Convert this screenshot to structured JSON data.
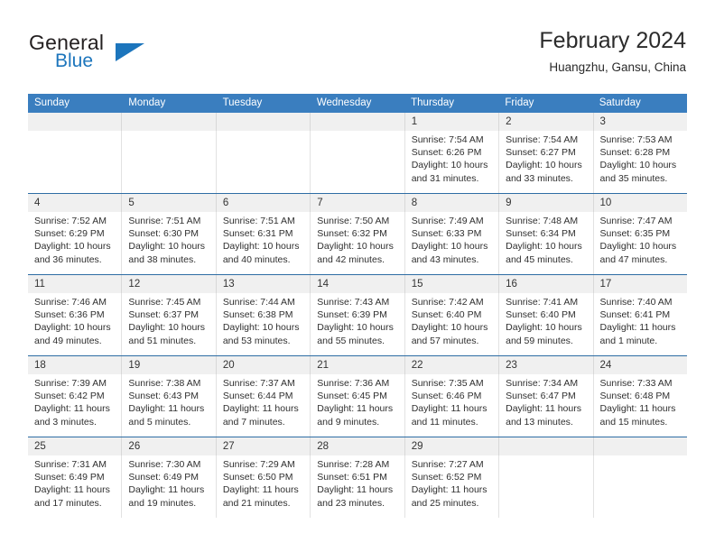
{
  "brand": {
    "name_part1": "General",
    "name_part2": "Blue",
    "logo_icon": "triangle-icon",
    "accent_color": "#1c75bc"
  },
  "header": {
    "title": "February 2024",
    "subtitle": "Huangzhu, Gansu, China"
  },
  "colors": {
    "header_blue": "#3a7ebf",
    "week_divider": "#2e6da4",
    "date_strip": "#f0f0f0"
  },
  "weekdays": [
    "Sunday",
    "Monday",
    "Tuesday",
    "Wednesday",
    "Thursday",
    "Friday",
    "Saturday"
  ],
  "weeks": [
    {
      "days": [
        {
          "date": "",
          "empty": true
        },
        {
          "date": "",
          "empty": true
        },
        {
          "date": "",
          "empty": true
        },
        {
          "date": "",
          "empty": true
        },
        {
          "date": "1",
          "sunrise": "Sunrise: 7:54 AM",
          "sunset": "Sunset: 6:26 PM",
          "daylight1": "Daylight: 10 hours",
          "daylight2": "and 31 minutes."
        },
        {
          "date": "2",
          "sunrise": "Sunrise: 7:54 AM",
          "sunset": "Sunset: 6:27 PM",
          "daylight1": "Daylight: 10 hours",
          "daylight2": "and 33 minutes."
        },
        {
          "date": "3",
          "sunrise": "Sunrise: 7:53 AM",
          "sunset": "Sunset: 6:28 PM",
          "daylight1": "Daylight: 10 hours",
          "daylight2": "and 35 minutes."
        }
      ]
    },
    {
      "days": [
        {
          "date": "4",
          "sunrise": "Sunrise: 7:52 AM",
          "sunset": "Sunset: 6:29 PM",
          "daylight1": "Daylight: 10 hours",
          "daylight2": "and 36 minutes."
        },
        {
          "date": "5",
          "sunrise": "Sunrise: 7:51 AM",
          "sunset": "Sunset: 6:30 PM",
          "daylight1": "Daylight: 10 hours",
          "daylight2": "and 38 minutes."
        },
        {
          "date": "6",
          "sunrise": "Sunrise: 7:51 AM",
          "sunset": "Sunset: 6:31 PM",
          "daylight1": "Daylight: 10 hours",
          "daylight2": "and 40 minutes."
        },
        {
          "date": "7",
          "sunrise": "Sunrise: 7:50 AM",
          "sunset": "Sunset: 6:32 PM",
          "daylight1": "Daylight: 10 hours",
          "daylight2": "and 42 minutes."
        },
        {
          "date": "8",
          "sunrise": "Sunrise: 7:49 AM",
          "sunset": "Sunset: 6:33 PM",
          "daylight1": "Daylight: 10 hours",
          "daylight2": "and 43 minutes."
        },
        {
          "date": "9",
          "sunrise": "Sunrise: 7:48 AM",
          "sunset": "Sunset: 6:34 PM",
          "daylight1": "Daylight: 10 hours",
          "daylight2": "and 45 minutes."
        },
        {
          "date": "10",
          "sunrise": "Sunrise: 7:47 AM",
          "sunset": "Sunset: 6:35 PM",
          "daylight1": "Daylight: 10 hours",
          "daylight2": "and 47 minutes."
        }
      ]
    },
    {
      "days": [
        {
          "date": "11",
          "sunrise": "Sunrise: 7:46 AM",
          "sunset": "Sunset: 6:36 PM",
          "daylight1": "Daylight: 10 hours",
          "daylight2": "and 49 minutes."
        },
        {
          "date": "12",
          "sunrise": "Sunrise: 7:45 AM",
          "sunset": "Sunset: 6:37 PM",
          "daylight1": "Daylight: 10 hours",
          "daylight2": "and 51 minutes."
        },
        {
          "date": "13",
          "sunrise": "Sunrise: 7:44 AM",
          "sunset": "Sunset: 6:38 PM",
          "daylight1": "Daylight: 10 hours",
          "daylight2": "and 53 minutes."
        },
        {
          "date": "14",
          "sunrise": "Sunrise: 7:43 AM",
          "sunset": "Sunset: 6:39 PM",
          "daylight1": "Daylight: 10 hours",
          "daylight2": "and 55 minutes."
        },
        {
          "date": "15",
          "sunrise": "Sunrise: 7:42 AM",
          "sunset": "Sunset: 6:40 PM",
          "daylight1": "Daylight: 10 hours",
          "daylight2": "and 57 minutes."
        },
        {
          "date": "16",
          "sunrise": "Sunrise: 7:41 AM",
          "sunset": "Sunset: 6:40 PM",
          "daylight1": "Daylight: 10 hours",
          "daylight2": "and 59 minutes."
        },
        {
          "date": "17",
          "sunrise": "Sunrise: 7:40 AM",
          "sunset": "Sunset: 6:41 PM",
          "daylight1": "Daylight: 11 hours",
          "daylight2": "and 1 minute."
        }
      ]
    },
    {
      "days": [
        {
          "date": "18",
          "sunrise": "Sunrise: 7:39 AM",
          "sunset": "Sunset: 6:42 PM",
          "daylight1": "Daylight: 11 hours",
          "daylight2": "and 3 minutes."
        },
        {
          "date": "19",
          "sunrise": "Sunrise: 7:38 AM",
          "sunset": "Sunset: 6:43 PM",
          "daylight1": "Daylight: 11 hours",
          "daylight2": "and 5 minutes."
        },
        {
          "date": "20",
          "sunrise": "Sunrise: 7:37 AM",
          "sunset": "Sunset: 6:44 PM",
          "daylight1": "Daylight: 11 hours",
          "daylight2": "and 7 minutes."
        },
        {
          "date": "21",
          "sunrise": "Sunrise: 7:36 AM",
          "sunset": "Sunset: 6:45 PM",
          "daylight1": "Daylight: 11 hours",
          "daylight2": "and 9 minutes."
        },
        {
          "date": "22",
          "sunrise": "Sunrise: 7:35 AM",
          "sunset": "Sunset: 6:46 PM",
          "daylight1": "Daylight: 11 hours",
          "daylight2": "and 11 minutes."
        },
        {
          "date": "23",
          "sunrise": "Sunrise: 7:34 AM",
          "sunset": "Sunset: 6:47 PM",
          "daylight1": "Daylight: 11 hours",
          "daylight2": "and 13 minutes."
        },
        {
          "date": "24",
          "sunrise": "Sunrise: 7:33 AM",
          "sunset": "Sunset: 6:48 PM",
          "daylight1": "Daylight: 11 hours",
          "daylight2": "and 15 minutes."
        }
      ]
    },
    {
      "days": [
        {
          "date": "25",
          "sunrise": "Sunrise: 7:31 AM",
          "sunset": "Sunset: 6:49 PM",
          "daylight1": "Daylight: 11 hours",
          "daylight2": "and 17 minutes."
        },
        {
          "date": "26",
          "sunrise": "Sunrise: 7:30 AM",
          "sunset": "Sunset: 6:49 PM",
          "daylight1": "Daylight: 11 hours",
          "daylight2": "and 19 minutes."
        },
        {
          "date": "27",
          "sunrise": "Sunrise: 7:29 AM",
          "sunset": "Sunset: 6:50 PM",
          "daylight1": "Daylight: 11 hours",
          "daylight2": "and 21 minutes."
        },
        {
          "date": "28",
          "sunrise": "Sunrise: 7:28 AM",
          "sunset": "Sunset: 6:51 PM",
          "daylight1": "Daylight: 11 hours",
          "daylight2": "and 23 minutes."
        },
        {
          "date": "29",
          "sunrise": "Sunrise: 7:27 AM",
          "sunset": "Sunset: 6:52 PM",
          "daylight1": "Daylight: 11 hours",
          "daylight2": "and 25 minutes."
        },
        {
          "date": "",
          "empty": true
        },
        {
          "date": "",
          "empty": true
        }
      ]
    }
  ]
}
